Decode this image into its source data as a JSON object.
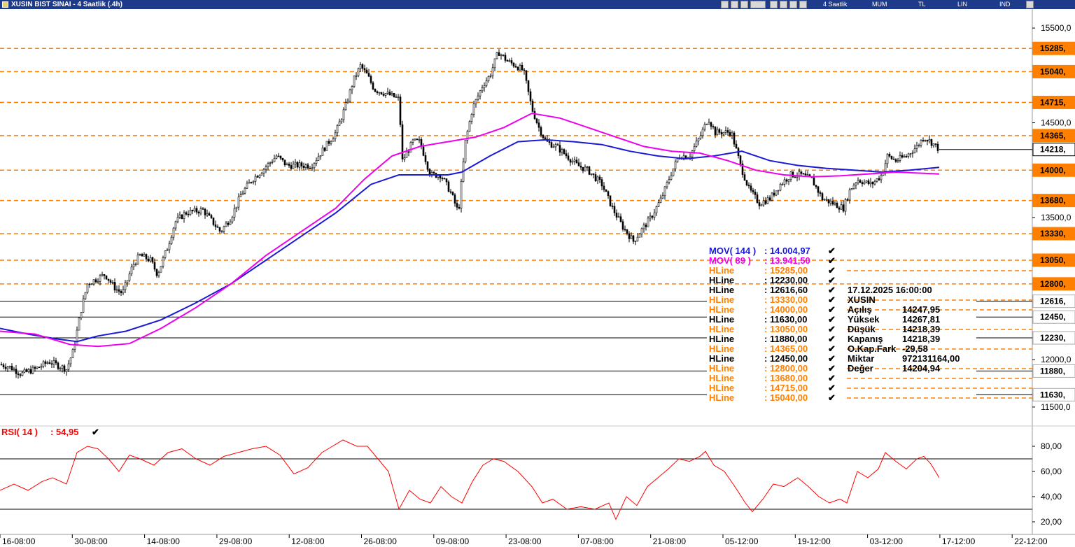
{
  "window": {
    "title": "XUSIN BIST SINAI - 4 Saatlik (.4h)",
    "toolbar": {
      "period": "4 Saatlik",
      "style": "MUM",
      "currency": "TL",
      "scale": "LIN",
      "mode": "IND"
    }
  },
  "chart_data": [
    {
      "type": "candlestick",
      "symbol": "XUSIN",
      "x_tick_labels": [
        "16-08:00",
        "30-08:00",
        "14-08:00",
        "29-08:00",
        "12-08:00",
        "26-08:00",
        "09-08:00",
        "23-08:00",
        "07-08:00",
        "21-08:00",
        "05-12:00",
        "19-12:00",
        "03-12:00",
        "17-12:00",
        "22-12:00"
      ],
      "y_tick_labels": [
        "15500,0",
        "14500,0",
        "13500,0",
        "12000,0",
        "11500,0"
      ],
      "y_ticks": [
        15500,
        14500,
        13500,
        12000,
        11500
      ],
      "ylim": [
        11300,
        15700
      ],
      "last_price_label": "14218,",
      "last_price": 14218.39,
      "close_path": [
        [
          0,
          11950
        ],
        [
          15,
          11920
        ],
        [
          30,
          11850
        ],
        [
          50,
          11900
        ],
        [
          70,
          11980
        ],
        [
          95,
          11900
        ],
        [
          105,
          12100
        ],
        [
          115,
          12500
        ],
        [
          125,
          12800
        ],
        [
          150,
          12900
        ],
        [
          165,
          12750
        ],
        [
          175,
          12700
        ],
        [
          190,
          13000
        ],
        [
          200,
          13100
        ],
        [
          215,
          13050
        ],
        [
          225,
          12900
        ],
        [
          240,
          13200
        ],
        [
          250,
          13450
        ],
        [
          265,
          13550
        ],
        [
          290,
          13580
        ],
        [
          315,
          13350
        ],
        [
          330,
          13500
        ],
        [
          345,
          13750
        ],
        [
          360,
          13900
        ],
        [
          375,
          14000
        ],
        [
          395,
          14150
        ],
        [
          410,
          14050
        ],
        [
          430,
          14050
        ],
        [
          445,
          14050
        ],
        [
          460,
          14200
        ],
        [
          480,
          14400
        ],
        [
          495,
          14700
        ],
        [
          505,
          14950
        ],
        [
          515,
          15100
        ],
        [
          525,
          15000
        ],
        [
          535,
          14850
        ],
        [
          555,
          14800
        ],
        [
          570,
          14750
        ],
        [
          575,
          14100
        ],
        [
          590,
          14300
        ],
        [
          600,
          14300
        ],
        [
          615,
          13950
        ],
        [
          630,
          13950
        ],
        [
          645,
          13750
        ],
        [
          655,
          13550
        ],
        [
          665,
          14300
        ],
        [
          675,
          14650
        ],
        [
          690,
          14900
        ],
        [
          700,
          15000
        ],
        [
          712,
          15250
        ],
        [
          725,
          15150
        ],
        [
          738,
          15100
        ],
        [
          748,
          15050
        ],
        [
          760,
          14650
        ],
        [
          770,
          14450
        ],
        [
          780,
          14300
        ],
        [
          795,
          14250
        ],
        [
          810,
          14150
        ],
        [
          825,
          14050
        ],
        [
          840,
          14000
        ],
        [
          860,
          13850
        ],
        [
          875,
          13600
        ],
        [
          890,
          13400
        ],
        [
          905,
          13250
        ],
        [
          915,
          13350
        ],
        [
          930,
          13500
        ],
        [
          945,
          13700
        ],
        [
          958,
          13950
        ],
        [
          970,
          14150
        ],
        [
          985,
          14150
        ],
        [
          1000,
          14350
        ],
        [
          1012,
          14550
        ],
        [
          1022,
          14400
        ],
        [
          1035,
          14400
        ],
        [
          1045,
          14400
        ],
        [
          1058,
          14050
        ],
        [
          1070,
          13800
        ],
        [
          1085,
          13650
        ],
        [
          1100,
          13700
        ],
        [
          1115,
          13850
        ],
        [
          1130,
          13950
        ],
        [
          1145,
          13950
        ],
        [
          1160,
          13900
        ],
        [
          1175,
          13700
        ],
        [
          1190,
          13650
        ],
        [
          1205,
          13600
        ],
        [
          1215,
          13800
        ],
        [
          1225,
          13900
        ],
        [
          1245,
          13850
        ],
        [
          1260,
          13950
        ],
        [
          1268,
          14150
        ],
        [
          1280,
          14100
        ],
        [
          1295,
          14150
        ],
        [
          1310,
          14250
        ],
        [
          1320,
          14350
        ],
        [
          1330,
          14300
        ],
        [
          1342,
          14218
        ]
      ],
      "series": [
        {
          "name": "MOV( 144 )",
          "label": "MOV( 144 )",
          "value_text": ": 14.004,97",
          "color": "#1a1ad6",
          "path": [
            [
              0,
              12330
            ],
            [
              40,
              12270
            ],
            [
              80,
              12220
            ],
            [
              110,
              12190
            ],
            [
              140,
              12250
            ],
            [
              180,
              12300
            ],
            [
              230,
              12420
            ],
            [
              280,
              12600
            ],
            [
              330,
              12800
            ],
            [
              380,
              13050
            ],
            [
              430,
              13300
            ],
            [
              480,
              13550
            ],
            [
              530,
              13850
            ],
            [
              570,
              13950
            ],
            [
              610,
              13950
            ],
            [
              640,
              13950
            ],
            [
              660,
              13980
            ],
            [
              700,
              14150
            ],
            [
              740,
              14300
            ],
            [
              780,
              14320
            ],
            [
              820,
              14300
            ],
            [
              860,
              14270
            ],
            [
              900,
              14200
            ],
            [
              940,
              14150
            ],
            [
              980,
              14120
            ],
            [
              1020,
              14150
            ],
            [
              1060,
              14200
            ],
            [
              1100,
              14100
            ],
            [
              1140,
              14050
            ],
            [
              1180,
              14020
            ],
            [
              1220,
              14000
            ],
            [
              1260,
              13980
            ],
            [
              1300,
              14000
            ],
            [
              1342,
              14030
            ]
          ]
        },
        {
          "name": "MOV( 89 )",
          "label": "MOV( 89 )",
          "value_text": ": 13.941,50",
          "color": "#ee00ee",
          "path": [
            [
              0,
              12300
            ],
            [
              50,
              12270
            ],
            [
              100,
              12160
            ],
            [
              140,
              12140
            ],
            [
              185,
              12170
            ],
            [
              230,
              12330
            ],
            [
              280,
              12550
            ],
            [
              330,
              12800
            ],
            [
              380,
              13100
            ],
            [
              430,
              13350
            ],
            [
              480,
              13600
            ],
            [
              520,
              13900
            ],
            [
              560,
              14150
            ],
            [
              600,
              14250
            ],
            [
              640,
              14300
            ],
            [
              680,
              14350
            ],
            [
              720,
              14450
            ],
            [
              760,
              14600
            ],
            [
              800,
              14550
            ],
            [
              840,
              14450
            ],
            [
              880,
              14350
            ],
            [
              920,
              14250
            ],
            [
              960,
              14200
            ],
            [
              1000,
              14180
            ],
            [
              1040,
              14100
            ],
            [
              1080,
              14000
            ],
            [
              1120,
              13950
            ],
            [
              1160,
              13930
            ],
            [
              1200,
              13940
            ],
            [
              1240,
              13960
            ],
            [
              1280,
              13980
            ],
            [
              1342,
              13960
            ]
          ]
        }
      ],
      "hlines": [
        {
          "label": "HLine",
          "value_text": ": 15285,00",
          "value": 15285,
          "color": "#ff8000",
          "box": "15285,"
        },
        {
          "label": "HLine",
          "value_text": ": 12230,00",
          "value": 12230,
          "color": "#000000",
          "box": "12230,"
        },
        {
          "label": "HLine",
          "value_text": ": 12616,60",
          "value": 12616.6,
          "color": "#000000",
          "box": "12616,"
        },
        {
          "label": "HLine",
          "value_text": ": 13330,00",
          "value": 13330,
          "color": "#ff8000",
          "box": "13330,"
        },
        {
          "label": "HLine",
          "value_text": ": 14000,00",
          "value": 14000,
          "color": "#ff8000",
          "box": "14000,"
        },
        {
          "label": "HLine",
          "value_text": ": 11630,00",
          "value": 11630,
          "color": "#000000",
          "box": "11630,"
        },
        {
          "label": "HLine",
          "value_text": ": 13050,00",
          "value": 13050,
          "color": "#ff8000",
          "box": "13050,"
        },
        {
          "label": "HLine",
          "value_text": ": 11880,00",
          "value": 11880,
          "color": "#000000",
          "box": "11880,"
        },
        {
          "label": "HLine",
          "value_text": ": 14365,00",
          "value": 14365,
          "color": "#ff8000",
          "box": "14365,"
        },
        {
          "label": "HLine",
          "value_text": ": 12450,00",
          "value": 12450,
          "color": "#000000",
          "box": "12450,"
        },
        {
          "label": "HLine",
          "value_text": ": 12800,00",
          "value": 12800,
          "color": "#ff8000",
          "box": "12800,"
        },
        {
          "label": "HLine",
          "value_text": ": 13680,00",
          "value": 13680,
          "color": "#ff8000",
          "box": "13680,"
        },
        {
          "label": "HLine",
          "value_text": ": 14715,00",
          "value": 14715,
          "color": "#ff8000",
          "box": "14715,"
        },
        {
          "label": "HLine",
          "value_text": ": 15040,00",
          "value": 15040,
          "color": "#ff8000",
          "box": "15040,"
        }
      ],
      "hline_extent_note": "solid",
      "info_box": {
        "datetime": "17.12.2025  16:00:00",
        "symbol": "XUSIN",
        "rows": [
          {
            "label": "Açılış",
            "value": "14247,95"
          },
          {
            "label": "Yüksek",
            "value": "14267,81"
          },
          {
            "label": "Düşük",
            "value": "14218,39"
          },
          {
            "label": "Kapanış",
            "value": "14218,39"
          },
          {
            "label": "O.Kap.Fark",
            "value": "-29,58"
          },
          {
            "label": "Miktar",
            "value": "972131164,00"
          },
          {
            "label": "Değer",
            "value": "14204,94"
          }
        ]
      }
    },
    {
      "type": "line",
      "indicator": "RSI( 14 )",
      "value_text": ": 54,95",
      "color": "#ff0000",
      "ylim": [
        10,
        95
      ],
      "y_tick_labels": [
        "80,00",
        "60,00",
        "40,00",
        "20,00"
      ],
      "y_ticks": [
        80,
        60,
        40,
        20
      ],
      "reference_lines": [
        70,
        30
      ],
      "path": [
        [
          0,
          45
        ],
        [
          20,
          50
        ],
        [
          40,
          45
        ],
        [
          60,
          52
        ],
        [
          75,
          55
        ],
        [
          95,
          50
        ],
        [
          110,
          75
        ],
        [
          125,
          80
        ],
        [
          140,
          78
        ],
        [
          155,
          70
        ],
        [
          170,
          60
        ],
        [
          185,
          73
        ],
        [
          200,
          70
        ],
        [
          220,
          65
        ],
        [
          240,
          75
        ],
        [
          260,
          78
        ],
        [
          280,
          70
        ],
        [
          300,
          65
        ],
        [
          320,
          72
        ],
        [
          340,
          75
        ],
        [
          360,
          78
        ],
        [
          380,
          80
        ],
        [
          400,
          73
        ],
        [
          420,
          58
        ],
        [
          440,
          63
        ],
        [
          460,
          75
        ],
        [
          475,
          80
        ],
        [
          490,
          85
        ],
        [
          510,
          80
        ],
        [
          525,
          80
        ],
        [
          540,
          70
        ],
        [
          555,
          60
        ],
        [
          570,
          30
        ],
        [
          585,
          45
        ],
        [
          600,
          38
        ],
        [
          615,
          35
        ],
        [
          630,
          48
        ],
        [
          645,
          40
        ],
        [
          660,
          35
        ],
        [
          675,
          52
        ],
        [
          690,
          65
        ],
        [
          705,
          70
        ],
        [
          720,
          68
        ],
        [
          740,
          60
        ],
        [
          760,
          48
        ],
        [
          775,
          35
        ],
        [
          790,
          38
        ],
        [
          810,
          30
        ],
        [
          830,
          32
        ],
        [
          850,
          30
        ],
        [
          870,
          35
        ],
        [
          880,
          22
        ],
        [
          895,
          40
        ],
        [
          910,
          33
        ],
        [
          925,
          48
        ],
        [
          940,
          55
        ],
        [
          955,
          62
        ],
        [
          970,
          70
        ],
        [
          985,
          68
        ],
        [
          1000,
          72
        ],
        [
          1008,
          76
        ],
        [
          1020,
          65
        ],
        [
          1035,
          60
        ],
        [
          1050,
          48
        ],
        [
          1065,
          35
        ],
        [
          1075,
          28
        ],
        [
          1090,
          38
        ],
        [
          1105,
          50
        ],
        [
          1120,
          48
        ],
        [
          1140,
          55
        ],
        [
          1155,
          48
        ],
        [
          1170,
          40
        ],
        [
          1185,
          35
        ],
        [
          1200,
          38
        ],
        [
          1210,
          35
        ],
        [
          1225,
          60
        ],
        [
          1240,
          55
        ],
        [
          1255,
          62
        ],
        [
          1265,
          75
        ],
        [
          1280,
          68
        ],
        [
          1295,
          62
        ],
        [
          1310,
          70
        ],
        [
          1320,
          72
        ],
        [
          1330,
          66
        ],
        [
          1342,
          55
        ]
      ]
    }
  ]
}
